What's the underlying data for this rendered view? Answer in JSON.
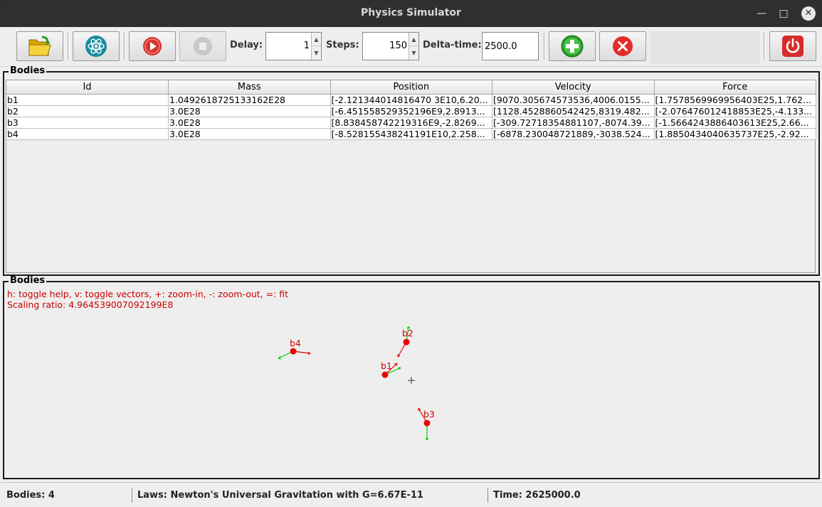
{
  "window": {
    "title": "Physics Simulator"
  },
  "toolbar": {
    "open_icon": "folder-open-icon",
    "physics_icon": "atom-icon",
    "run_icon": "play-icon",
    "stop_icon": "stop-icon",
    "delay_label": "Delay:",
    "delay_value": "1",
    "steps_label": "Steps:",
    "steps_value": "150",
    "dt_label": "Delta-time:",
    "dt_value": "2500.0",
    "add_icon": "plus-circle-icon",
    "remove_icon": "x-circle-icon",
    "exit_icon": "power-icon"
  },
  "bodies_table": {
    "title": "Bodies",
    "columns": [
      "Id",
      "Mass",
      "Position",
      "Velocity",
      "Force"
    ],
    "rows": [
      [
        "b1",
        "1.0492618725133162E28",
        "[-2.121344014816470 3E10,6.20...",
        "[9070.305674573536,4006.0155...",
        "[1.7578569969956403E25,1.762..."
      ],
      [
        "b2",
        "3.0E28",
        "[-6.451558529352196E9,2.8913...",
        "[1128.4528860542425,8319.482...",
        "[-2.076476012418853E25,-4.133..."
      ],
      [
        "b3",
        "3.0E28",
        "[8.838458742219316E9,-2.8269...",
        "[-309.72718354881107,-8074.39...",
        "[-1.5664243886403613E25,2.66..."
      ],
      [
        "b4",
        "3.0E28",
        "[-8.528155438241191E10,2.258...",
        "[-6878.230048721889,-3038.524...",
        "[1.8850434040635737E25,-2.92..."
      ]
    ]
  },
  "viewer": {
    "title": "Bodies",
    "help_text": "h: toggle help, v: toggle vectors, +: zoom-in, -: zoom-out, =: fit",
    "scaling_text": "Scaling ratio: 4.964539007092199E8",
    "body_labels": [
      "b1",
      "b2",
      "b3",
      "b4"
    ]
  },
  "status": {
    "bodies": "Bodies: 4",
    "laws": "Laws: Newton's Universal Gravitation with G=6.67E-11",
    "time": "Time: 2625000.0"
  },
  "colors": {
    "body": "#ee0000",
    "velocity": "#00cc00",
    "force": "#dd0000",
    "help_text": "#cc0000"
  }
}
